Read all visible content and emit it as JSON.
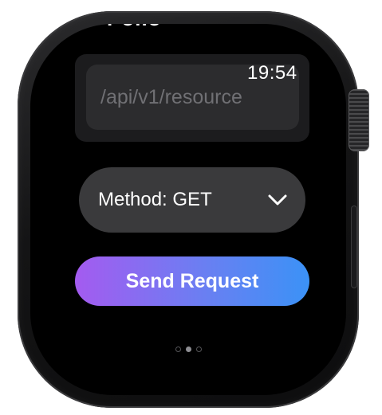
{
  "status": {
    "time": "19:54",
    "scrolled_header_fragment": "Pollo"
  },
  "request_form": {
    "path_field_placeholder": "/api/v1/resource",
    "method_label": "Method: GET",
    "send_label": "Send Request"
  },
  "pagination": {
    "total": 3,
    "active_index": 1
  },
  "icons": {
    "method_picker": "chevron-down-icon"
  },
  "colors": {
    "screen_background": "#000000",
    "field_background": "#2c2c2e",
    "picker_background": "#3a3a3c",
    "button_gradient_start": "#a45bf0",
    "button_gradient_end": "#3b92f6"
  }
}
